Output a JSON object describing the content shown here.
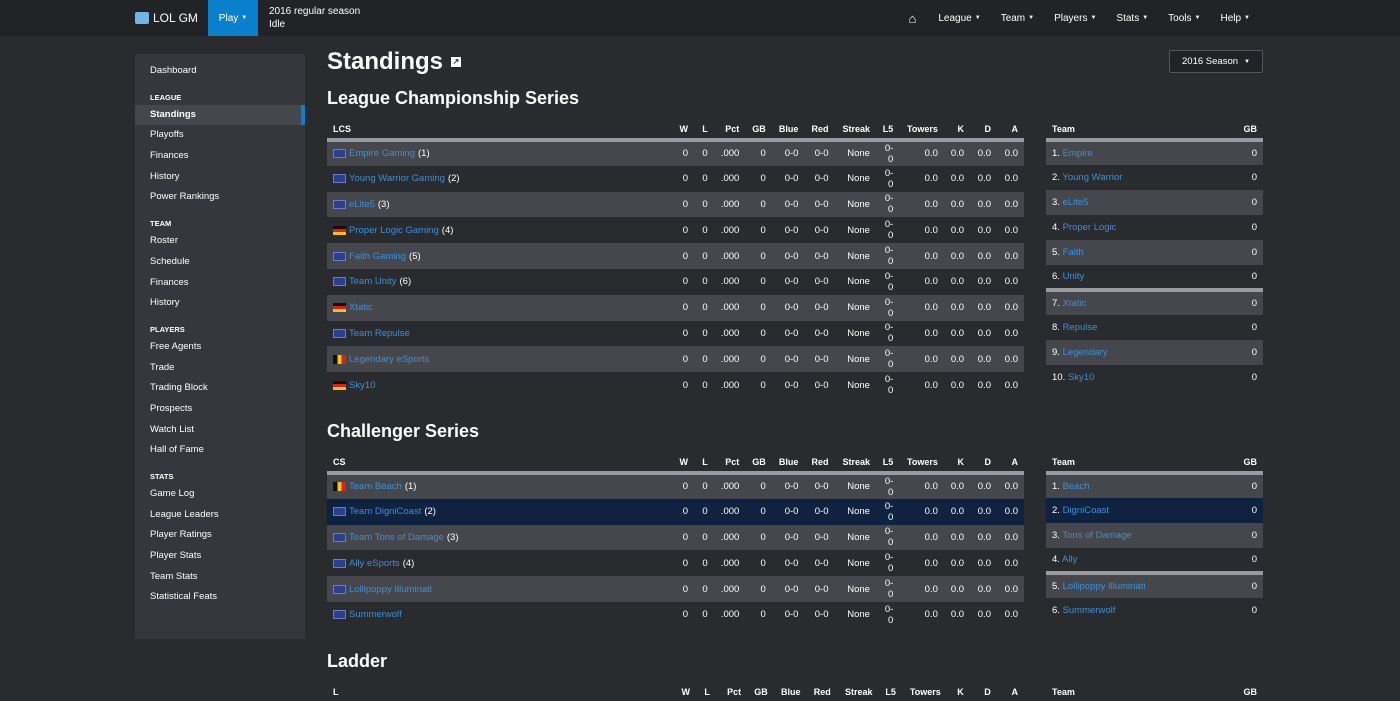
{
  "nav": {
    "brand": "LOL GM",
    "play": "Play",
    "season_line1": "2016 regular season",
    "season_line2": "Idle",
    "items": [
      "League",
      "Team",
      "Players",
      "Stats",
      "Tools",
      "Help"
    ]
  },
  "sidebar": {
    "dashboard": "Dashboard",
    "sections": [
      {
        "head": "LEAGUE",
        "items": [
          "Standings",
          "Playoffs",
          "Finances",
          "History",
          "Power Rankings"
        ]
      },
      {
        "head": "TEAM",
        "items": [
          "Roster",
          "Schedule",
          "Finances",
          "History"
        ]
      },
      {
        "head": "PLAYERS",
        "items": [
          "Free Agents",
          "Trade",
          "Trading Block",
          "Prospects",
          "Watch List",
          "Hall of Fame"
        ]
      },
      {
        "head": "STATS",
        "items": [
          "Game Log",
          "League Leaders",
          "Player Ratings",
          "Player Stats",
          "Team Stats",
          "Statistical Feats"
        ]
      }
    ]
  },
  "main": {
    "title": "Standings",
    "season_select": "2016 Season",
    "columns": [
      "W",
      "L",
      "Pct",
      "GB",
      "Blue",
      "Red",
      "Streak",
      "L5",
      "Towers",
      "K",
      "D",
      "A"
    ],
    "side_headers": [
      "Team",
      "GB"
    ],
    "conferences": [
      {
        "name": "League Championship Series",
        "abbrev": "LCS",
        "teams": [
          {
            "flag": "eu",
            "name": "Empire Gaming",
            "seed": "(1)"
          },
          {
            "flag": "eu",
            "name": "Young Warrior Gaming",
            "seed": "(2)"
          },
          {
            "flag": "eu",
            "name": "eLite5",
            "seed": "(3)"
          },
          {
            "flag": "de",
            "name": "Proper Logic Gaming",
            "seed": "(4)"
          },
          {
            "flag": "eu",
            "name": "Faith Gaming",
            "seed": "(5)"
          },
          {
            "flag": "eu",
            "name": "Team Unity",
            "seed": "(6)"
          },
          {
            "flag": "de",
            "name": "Xtatic",
            "seed": ""
          },
          {
            "flag": "eu",
            "name": "Team Repulse",
            "seed": ""
          },
          {
            "flag": "be",
            "name": "Legendary eSports",
            "seed": ""
          },
          {
            "flag": "de",
            "name": "Sky10",
            "seed": ""
          }
        ],
        "side": [
          "1. Empire",
          "2. Young Warrior",
          "3. eLite5",
          "4. Proper Logic",
          "5. Faith",
          "6. Unity",
          "7. Xtatic",
          "8. Repulse",
          "9. Legendary",
          "10. Sky10"
        ]
      },
      {
        "name": "Challenger Series",
        "abbrev": "CS",
        "teams": [
          {
            "flag": "be",
            "name": "Team Beach",
            "seed": "(1)"
          },
          {
            "flag": "eu",
            "name": "Team DigniCoast",
            "seed": "(2)"
          },
          {
            "flag": "eu",
            "name": "Team Tons of Damage",
            "seed": "(3)"
          },
          {
            "flag": "eu",
            "name": "Ally eSports",
            "seed": "(4)"
          },
          {
            "flag": "eu",
            "name": "Lollipoppy Illuminati",
            "seed": ""
          },
          {
            "flag": "eu",
            "name": "Summerwolf",
            "seed": ""
          }
        ],
        "side": [
          "1. Beach",
          "2. DigniCoast",
          "3. Tons of Damage",
          "4. Ally",
          "5. Lollipoppy Illuminati",
          "6. Summerwolf"
        ]
      },
      {
        "name": "Ladder",
        "abbrev": "L",
        "teams": [],
        "side": []
      }
    ],
    "row_values": [
      "0",
      "0",
      ".000",
      "0",
      "0-0",
      "0-0",
      "None",
      "0-0",
      "0.0",
      "0.0",
      "0.0",
      "0.0"
    ],
    "side_gb": "0"
  },
  "colors": {
    "accent": "#0a80cc",
    "link": "#3a90d8",
    "highlight_row": "#0f2340"
  }
}
